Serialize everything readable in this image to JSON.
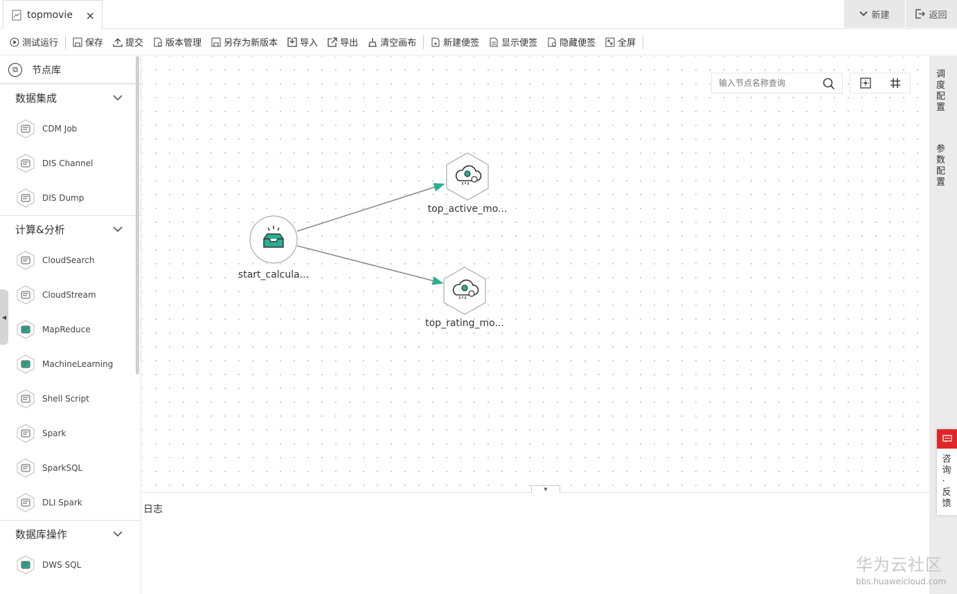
{
  "tab": {
    "title": "topmovie",
    "close": "×"
  },
  "top_right": {
    "new_label": "新建",
    "back_label": "返回"
  },
  "toolbar": {
    "test_run": "测试运行",
    "save": "保存",
    "submit": "提交",
    "version_manage": "版本管理",
    "save_as_new": "另存为新版本",
    "import": "导入",
    "export": "导出",
    "clear_canvas": "清空画布",
    "new_note": "新建便签",
    "show_note": "显示便签",
    "hide_note": "隐藏便签",
    "fullscreen": "全屏"
  },
  "sidebar": {
    "title": "节点库",
    "groups": [
      {
        "label": "数据集成",
        "items": [
          "CDM Job",
          "DIS Channel",
          "DIS Dump"
        ]
      },
      {
        "label": "计算&分析",
        "items": [
          "CloudSearch",
          "CloudStream",
          "MapReduce",
          "MachineLearning",
          "Shell Script",
          "Spark",
          "SparkSQL",
          "DLI Spark"
        ]
      },
      {
        "label": "数据库操作",
        "items": [
          "DWS SQL"
        ]
      }
    ]
  },
  "canvas": {
    "search_placeholder": "输入节点名称查询",
    "nodes": {
      "start": "start_calcula...",
      "active": "top_active_mo...",
      "rating": "top_rating_mo..."
    }
  },
  "right_panel": {
    "schedule": "调度配置",
    "params": "参数配置",
    "feedback": "咨询·反馈"
  },
  "log": {
    "title": "日志"
  },
  "watermark": {
    "brand": "华为云社区",
    "url": "bbs.huaweicloud.com"
  },
  "colors": {
    "accent": "#2bae92",
    "feedback": "#e0262a"
  }
}
